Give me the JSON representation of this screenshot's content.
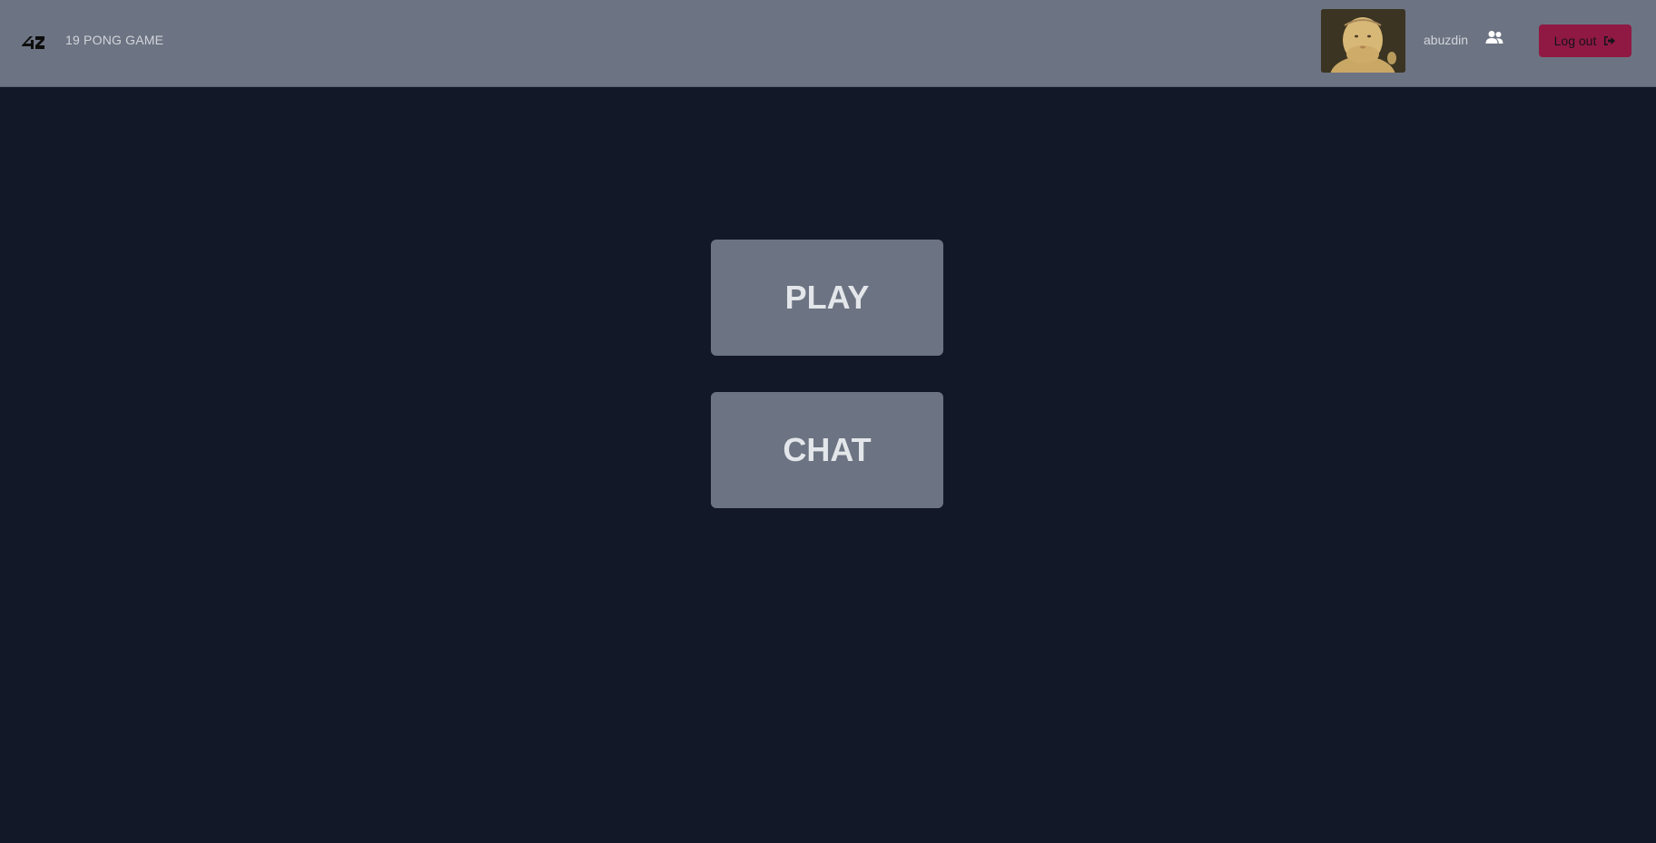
{
  "header": {
    "logo_icon": "42-logo-icon",
    "brand": "19 PONG GAME",
    "avatar_icon": "user-avatar-image",
    "username": "abuzdin",
    "friends_icon": "users-icon",
    "logout_label": "Log out",
    "logout_icon": "sign-out-icon"
  },
  "main": {
    "play_label": "PLAY",
    "chat_label": "CHAT"
  },
  "colors": {
    "background": "#121828",
    "navbar": "#6c7382",
    "button": "#6c7382",
    "logout": "#8f1942",
    "button_text": "#e3e6ea"
  }
}
